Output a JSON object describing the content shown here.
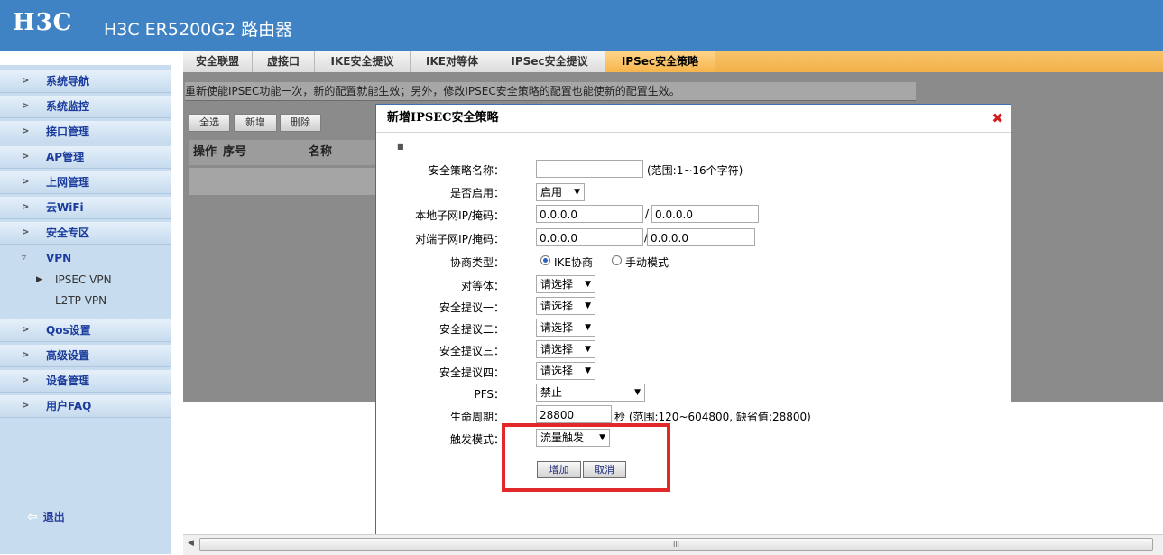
{
  "header": {
    "logo": "H3C",
    "title": "H3C ER5200G2 路由器"
  },
  "sidebar": {
    "items": [
      {
        "label": "系统导航"
      },
      {
        "label": "系统监控"
      },
      {
        "label": "接口管理"
      },
      {
        "label": "AP管理"
      },
      {
        "label": "上网管理"
      },
      {
        "label": "云WiFi"
      },
      {
        "label": "安全专区"
      },
      {
        "label": "VPN"
      },
      {
        "label": "Qos设置"
      },
      {
        "label": "高级设置"
      },
      {
        "label": "设备管理"
      },
      {
        "label": "用户FAQ"
      }
    ],
    "vpn_sub": [
      {
        "label": "IPSEC VPN"
      },
      {
        "label": "L2TP VPN"
      }
    ],
    "logout": "退出"
  },
  "tabs": [
    {
      "label": "安全联盟"
    },
    {
      "label": "虚接口"
    },
    {
      "label": "IKE安全提议"
    },
    {
      "label": "IKE对等体"
    },
    {
      "label": "IPSec安全提议"
    },
    {
      "label": "IPSec安全策略"
    }
  ],
  "notice": "重新使能IPSEC功能一次，新的配置就能生效；另外，修改IPSEC安全策略的配置也能使新的配置生效。",
  "toolbar": {
    "select_all": "全选",
    "add": "新增",
    "delete": "删除"
  },
  "grid": {
    "col_op": "操作",
    "col_no": "序号",
    "col_name": "名称"
  },
  "modal": {
    "title": "新增IPSEC安全策略",
    "close": "✖",
    "fields": {
      "name_label": "安全策略名称：",
      "name_value": "",
      "name_hint": "(范围:1~16个字符)",
      "enable_label": "是否启用：",
      "enable_value": "启用",
      "local_label": "本地子网IP/掩码：",
      "local_ip": "0.0.0.0",
      "local_mask": "0.0.0.0",
      "remote_label": "对端子网IP/掩码：",
      "remote_ip": "0.0.0.0",
      "remote_mask": "0.0.0.0",
      "slash": "/",
      "mode_label": "协商类型：",
      "mode_ike": "IKE协商",
      "mode_manual": "手动模式",
      "peer_label": "对等体：",
      "peer_value": "请选择",
      "prop1_label": "安全提议一：",
      "prop1_value": "请选择",
      "prop2_label": "安全提议二：",
      "prop2_value": "请选择",
      "prop3_label": "安全提议三：",
      "prop3_value": "请选择",
      "prop4_label": "安全提议四：",
      "prop4_value": "请选择",
      "pfs_label": "PFS：",
      "pfs_value": "禁止",
      "life_label": "生命周期：",
      "life_value": "28800",
      "life_hint": "秒 (范围:120~604800, 缺省值:28800)",
      "trigger_label": "触发模式：",
      "trigger_value": "流量触发"
    },
    "buttons": {
      "add": "增加",
      "cancel": "取消"
    }
  },
  "scrollbar": {
    "grip": "III"
  }
}
